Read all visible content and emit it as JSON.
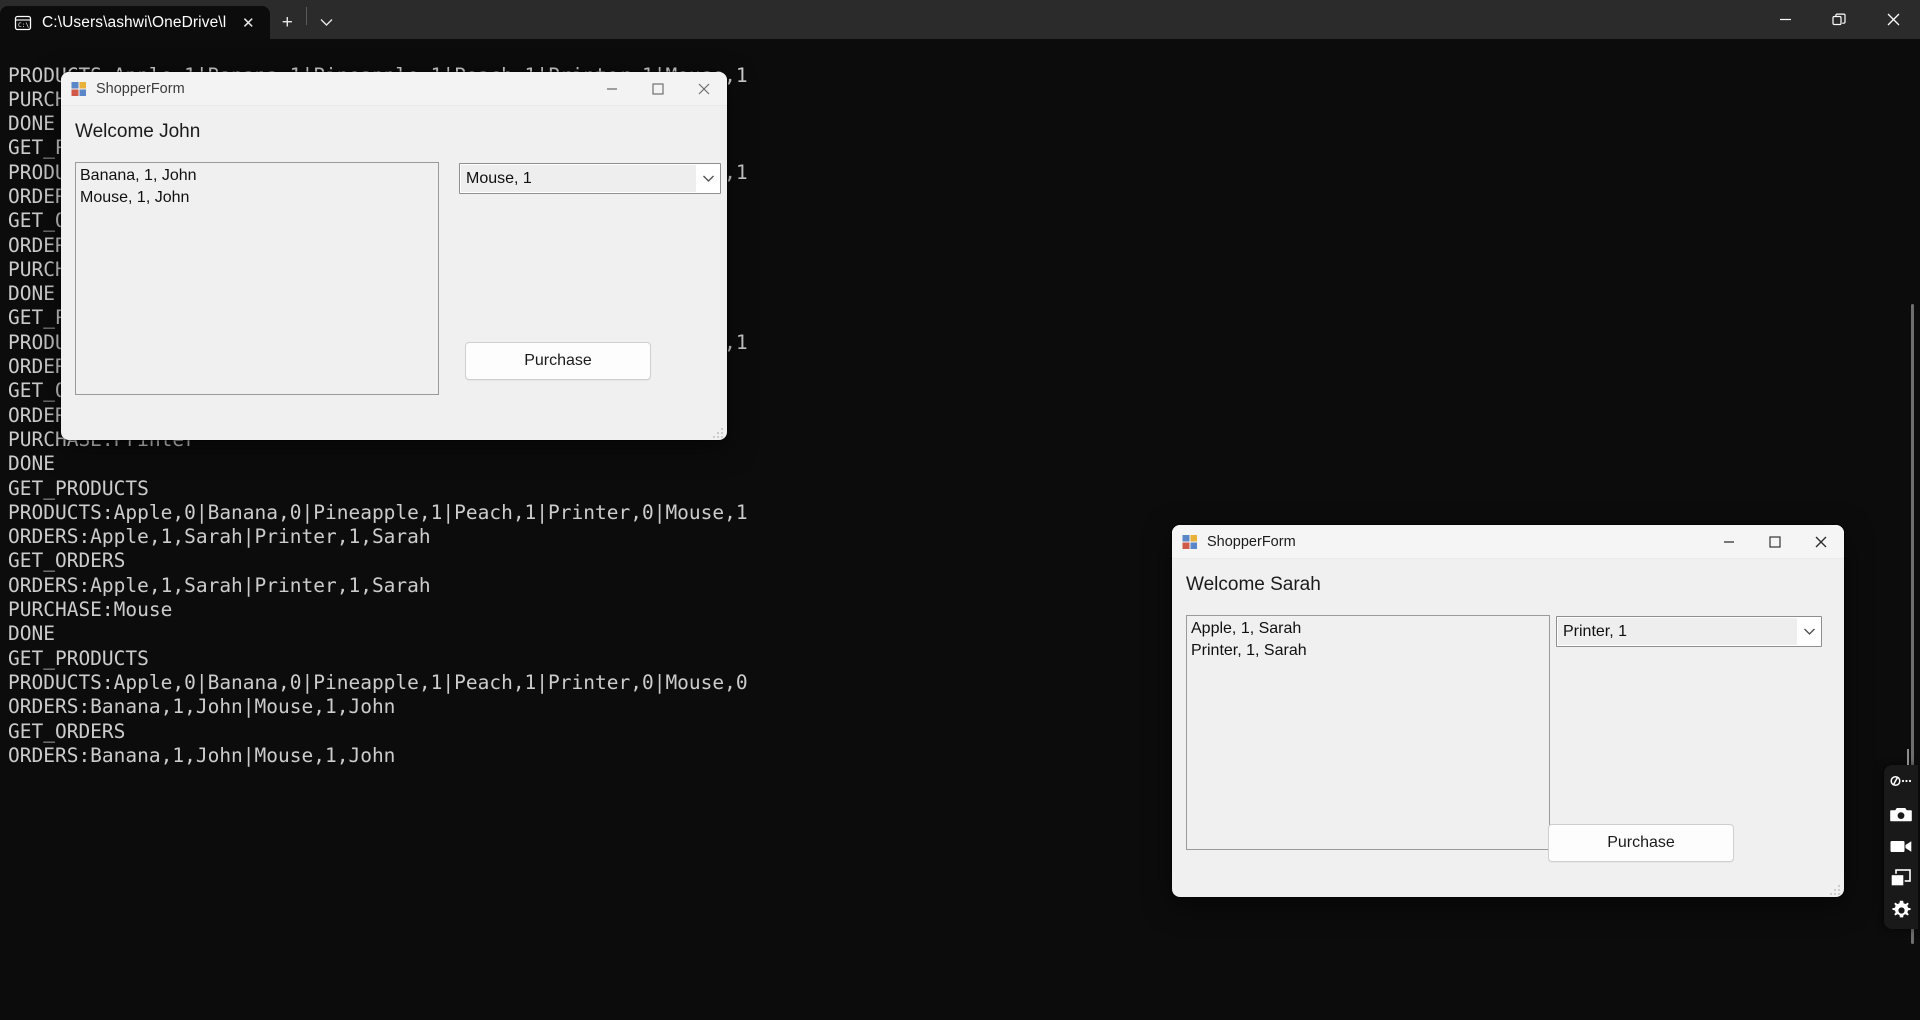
{
  "terminal": {
    "tab": {
      "title": "C:\\Users\\ashwi\\OneDrive\\l",
      "icon": "console-icon",
      "close_label": "✕",
      "new_tab_label": "+",
      "dropdown_label": "⌄"
    },
    "window_controls": {
      "minimize": "minimize-icon",
      "restore": "restore-icon",
      "close": "close-icon"
    },
    "log": "PRODUCTS:Apple,1|Banana,1|Pineapple,1|Peach,1|Printer,1|Mouse,1\nPURCHASE:Banana\nDONE\nGET_PRODUCTS\nPRODUCTS:Apple,1|Banana,0|Pineapple,1|Peach,1|Printer,1|Mouse,1\nORDERS:Banana,1,John\nGET_ORDERS\nORDERS:Banana,1,John\nPURCHASE:Apple\nDONE\nGET_PRODUCTS\nPRODUCTS:Apple,0|Banana,0|Pineapple,1|Peach,1|Printer,1|Mouse,1\nORDERS:Apple,1,Sarah\nGET_ORDERS\nORDERS:Apple,1,Sarah\nPURCHASE:Printer\nDONE\nGET_PRODUCTS\nPRODUCTS:Apple,0|Banana,0|Pineapple,1|Peach,1|Printer,0|Mouse,1\nORDERS:Apple,1,Sarah|Printer,1,Sarah\nGET_ORDERS\nORDERS:Apple,1,Sarah|Printer,1,Sarah\nPURCHASE:Mouse\nDONE\nGET_PRODUCTS\nPRODUCTS:Apple,0|Banana,0|Pineapple,1|Peach,1|Printer,0|Mouse,0\nORDERS:Banana,1,John|Mouse,1,John\nGET_ORDERS\nORDERS:Banana,1,John|Mouse,1,John"
  },
  "shopper_john": {
    "title": "ShopperForm",
    "welcome": "Welcome John",
    "orders": [
      "Banana, 1, John",
      "Mouse, 1, John"
    ],
    "product_selected": "Mouse, 1",
    "purchase_label": "Purchase"
  },
  "shopper_sarah": {
    "title": "ShopperForm",
    "welcome": "Welcome Sarah",
    "orders": [
      "Apple, 1, Sarah",
      "Printer, 1, Sarah"
    ],
    "product_selected": "Printer, 1",
    "purchase_label": "Purchase"
  },
  "capture_toolbar": {
    "items": [
      "record-menu-icon",
      "camera-icon",
      "video-camera-icon",
      "windows-stack-icon",
      "gear-icon"
    ]
  },
  "colors": {
    "terminal_bg": "#0c0c0c",
    "terminal_chrome": "#2b2b2b",
    "terminal_text": "#cccccc",
    "form_bg": "#f0f0f0",
    "form_titlebar": "#f3f3f3"
  }
}
